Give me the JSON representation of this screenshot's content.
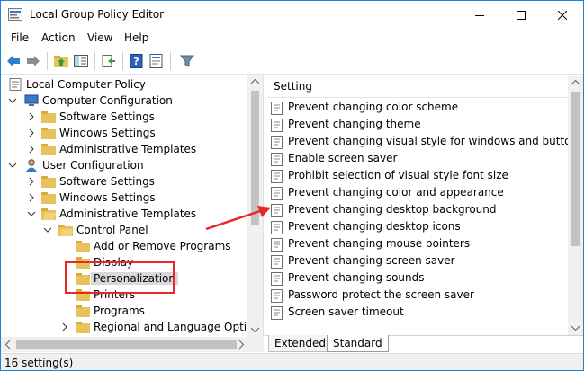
{
  "window": {
    "title": "Local Group Policy Editor"
  },
  "menu": [
    "File",
    "Action",
    "View",
    "Help"
  ],
  "toolbar": {
    "buttons": [
      "back-icon",
      "forward-icon",
      "up-folder-icon",
      "show-hide-tree-icon",
      "export-list-icon",
      "help-icon",
      "properties-icon",
      "filter-icon"
    ]
  },
  "tree": {
    "root": "Local Computer Policy",
    "items": [
      "Computer Configuration",
      "Software Settings",
      "Windows Settings",
      "Administrative Templates",
      "User Configuration",
      "Software Settings",
      "Windows Settings",
      "Administrative Templates",
      "Control Panel",
      "Add or Remove Programs",
      "Display",
      "Personalization",
      "Printers",
      "Programs",
      "Regional and Language Options"
    ]
  },
  "settings": {
    "header": "Setting",
    "items": [
      "Prevent changing color scheme",
      "Prevent changing theme",
      "Prevent changing visual style for windows and buttons",
      "Enable screen saver",
      "Prohibit selection of visual style font size",
      "Prevent changing color and appearance",
      "Prevent changing desktop background",
      "Prevent changing desktop icons",
      "Prevent changing mouse pointers",
      "Prevent changing screen saver",
      "Prevent changing sounds",
      "Password protect the screen saver",
      "Screen saver timeout"
    ]
  },
  "tabs": [
    "Extended",
    "Standard"
  ],
  "status": "16 setting(s)",
  "colors": {
    "accent": "#1883d7",
    "annotation": "#e8262b",
    "folder": "#e8c25c"
  }
}
